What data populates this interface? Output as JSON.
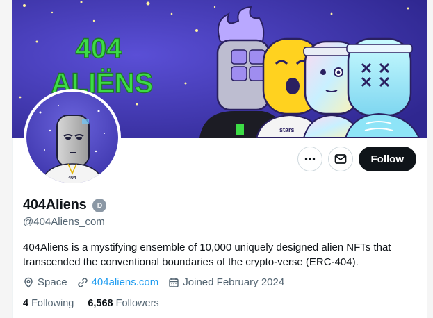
{
  "banner": {
    "logo_line1": "404",
    "logo_line2": "ALIËNS",
    "shirt_text": "stars"
  },
  "avatar": {
    "tag_text": "404"
  },
  "actions": {
    "more_icon": "more-horizontal-icon",
    "message_icon": "mail-icon",
    "follow_label": "Follow"
  },
  "profile": {
    "display_name": "404Aliens",
    "verified_badge": "ID",
    "handle": "@404Aliens_com",
    "bio": "404Aliens is a mystifying ensemble of 10,000 uniquely designed alien NFTs that transcended the conventional boundaries of the crypto-verse (ERC-404).",
    "location": "Space",
    "website": "404aliens.com",
    "joined": "Joined February 2024"
  },
  "stats": {
    "following_count": "4",
    "following_label": "Following",
    "followers_count": "6,568",
    "followers_label": "Followers"
  },
  "colors": {
    "follow_button_bg": "#0f1419",
    "link": "#1d9bf0",
    "secondary_text": "#536471",
    "banner_bg": "#4b3fb8",
    "banner_logo": "#3ddc46"
  }
}
